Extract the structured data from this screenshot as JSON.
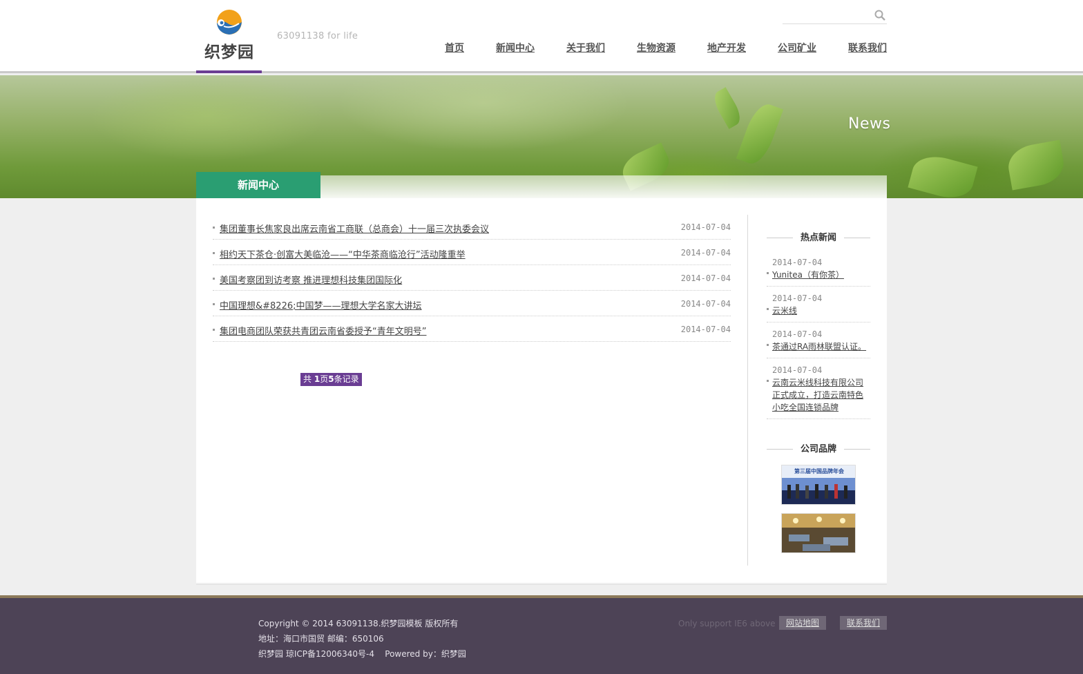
{
  "brand": {
    "logo_text": "织梦园",
    "slogan": "63091138 for life"
  },
  "search": {
    "placeholder": "",
    "value": ""
  },
  "nav": [
    {
      "label": "首页"
    },
    {
      "label": "新闻中心"
    },
    {
      "label": "关于我们"
    },
    {
      "label": "生物资源"
    },
    {
      "label": "地产开发"
    },
    {
      "label": "公司矿业"
    },
    {
      "label": "联系我们"
    }
  ],
  "banner": {
    "title": "News"
  },
  "section_tab": "新闻中心",
  "news": [
    {
      "title": "集团董事长焦家良出席云南省工商联（总商会）十一届三次执委会议",
      "date": "2014-07-04"
    },
    {
      "title": "相约天下茶仓·创富大美临沧——“中华茶商临沧行”活动隆重举",
      "date": "2014-07-04"
    },
    {
      "title": "美国考察团到访考察 推进理想科技集团国际化",
      "date": "2014-07-04"
    },
    {
      "title": "中国理想&#8226;中国梦——理想大学名家大讲坛",
      "date": "2014-07-04"
    },
    {
      "title": "集团电商团队荣获共青团云南省委授予“青年文明号”",
      "date": "2014-07-04"
    }
  ],
  "pager": {
    "prefix": "共 ",
    "pages": "1",
    "mid": "页",
    "records": "5",
    "suffix": "条记录"
  },
  "sidebar": {
    "hot_heading": "热点新闻",
    "hot_news": [
      {
        "date": "2014-07-04",
        "title": "Yunitea（有你茶）"
      },
      {
        "date": "2014-07-04",
        "title": "云米线"
      },
      {
        "date": "2014-07-04",
        "title": "茶通过RA雨林联盟认证。"
      },
      {
        "date": "2014-07-04",
        "title": "云南云米线科技有限公司正式成立，打造云南特色小吃全国连锁品牌"
      }
    ],
    "brand_heading": "公司品牌",
    "brand_image_caption": "第三届中国品牌年会"
  },
  "footer": {
    "copyright": "Copyright © 2014 63091138.织梦园模板 版权所有",
    "address": "地址：海口市国贸 邮编：650106",
    "icp": "织梦园 琼ICP备12006340号-4",
    "powered": "Powered by：织梦园",
    "support": "Only support IE6 above",
    "sitemap": "网站地图",
    "contact": "联系我们"
  },
  "colors": {
    "accent_purple": "#6a3d93",
    "tab_green": "#2a9e72",
    "footer_bg": "#4d4356"
  }
}
